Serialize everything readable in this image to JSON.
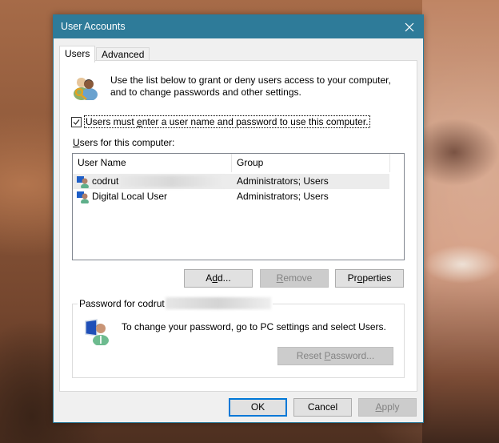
{
  "window": {
    "title": "User Accounts",
    "close_label": "Close",
    "accent_color": "#2e7b99"
  },
  "tabs": [
    {
      "label": "Users",
      "active": true
    },
    {
      "label": "Advanced",
      "active": false
    }
  ],
  "intro": {
    "icon": "users-key-icon",
    "text": "Use the list below to grant or deny users access to your computer, and to change passwords and other settings."
  },
  "require_login": {
    "label_prefix": "Users must ",
    "label_accel": "e",
    "label_suffix": "nter a user name and password to use this computer.",
    "checked": true
  },
  "users_list": {
    "label_accel": "U",
    "label_rest": "sers for this computer:",
    "columns": [
      "User Name",
      "Group"
    ],
    "rows": [
      {
        "name": "codrut",
        "name_redacted": true,
        "group": "Administrators; Users",
        "selected": true
      },
      {
        "name": "Digital Local User",
        "name_redacted": false,
        "group": "Administrators; Users",
        "selected": false
      }
    ]
  },
  "list_buttons": {
    "add": {
      "pre": "A",
      "accel": "d",
      "post": "d...",
      "enabled": true
    },
    "remove": {
      "pre": "",
      "accel": "R",
      "post": "emove",
      "enabled": false
    },
    "properties": {
      "pre": "Pr",
      "accel": "o",
      "post": "perties",
      "enabled": true
    }
  },
  "password_group": {
    "legend": "Password for codrut",
    "legend_redacted": true,
    "icon": "user-computer-icon",
    "text": "To change your password, go to PC settings and select Users.",
    "reset_button": {
      "pre": "Reset ",
      "accel": "P",
      "post": "assword...",
      "enabled": false
    }
  },
  "footer_buttons": {
    "ok": {
      "label": "OK",
      "default": true,
      "enabled": true
    },
    "cancel": {
      "label": "Cancel",
      "enabled": true
    },
    "apply": {
      "accel": "A",
      "post": "pply",
      "enabled": false
    }
  }
}
